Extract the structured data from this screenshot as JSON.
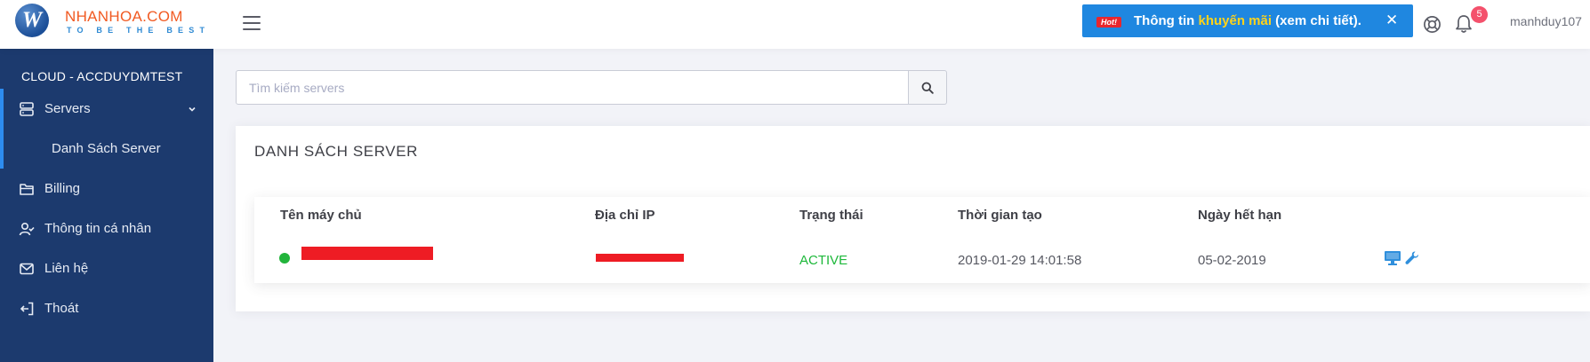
{
  "header": {
    "logo_letter": "W",
    "brand": "NHANHOA.COM",
    "tagline": "TO BE THE BEST",
    "promo": {
      "badge": "Hot!",
      "text_before": "Thông tin ",
      "text_highlight": "khuyến mãi",
      "text_after": " (xem chi tiết).",
      "close": "✕",
      "highlight_color": "#ffd31a"
    },
    "notification_count": "5",
    "username": "manhduy107"
  },
  "sidebar": {
    "title": "CLOUD - ACCDUYDMTEST",
    "items": [
      {
        "label": "Servers",
        "icon": "server-icon"
      },
      {
        "label": "Billing",
        "icon": "folder-icon"
      },
      {
        "label": "Thông tin cá nhân",
        "icon": "user-check-icon"
      },
      {
        "label": "Liên hệ",
        "icon": "mail-icon"
      },
      {
        "label": "Thoát",
        "icon": "logout-icon"
      }
    ],
    "subitems": [
      "Danh Sách Server"
    ]
  },
  "search": {
    "placeholder": "Tìm kiếm servers"
  },
  "main": {
    "title": "DANH SÁCH SERVER",
    "table": {
      "columns": [
        "Tên máy chủ",
        "Địa chỉ IP",
        "Trạng thái",
        "Thời gian tạo",
        "Ngày hết hạn"
      ],
      "rows": [
        {
          "status": "ACTIVE",
          "created": "2019-01-29 14:01:58",
          "expires": "05-02-2019"
        }
      ]
    }
  },
  "colors": {
    "sidebar_bg": "#1c3a6e",
    "accent": "#1f87e0",
    "active": "#1db83a",
    "redaction": "#ee1c24"
  }
}
